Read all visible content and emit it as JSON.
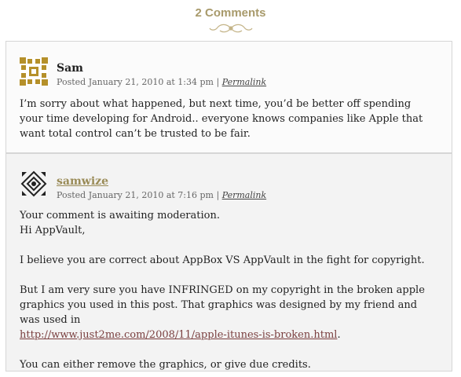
{
  "heading": "2 Comments",
  "comments": [
    {
      "author": "Sam",
      "meta_prefix": "Posted January 21, 2010 at 1:34 pm | ",
      "permalink": "Permalink",
      "body": "I’m sorry about what happened, but next time, you’d be better off spending your time developing for Android.. everyone knows companies like Apple that want total control can’t be trusted to be fair."
    },
    {
      "author": "samwize",
      "meta_prefix": "Posted January 21, 2010 at 7:16 pm | ",
      "permalink": "Permalink",
      "moderation": "Your comment is awaiting moderation.",
      "greeting": "Hi AppVault,",
      "p1": "I believe you are correct about AppBox VS AppVault in the fight for copyright.",
      "p2": "But I am very sure you have INFRINGED on my copyright in the broken apple graphics you used in this post. That graphics was designed by my friend and was used in",
      "link": "http://www.just2me.com/2008/11/apple-itunes-is-broken.html",
      "link_suffix": ".",
      "p3": "You can either remove the graphics, or give due credits."
    }
  ],
  "colors": {
    "heading": "#a89a6b",
    "author_link": "#9a8b57",
    "avatar_gold": "#b5902a",
    "link": "#7a3f3f"
  }
}
